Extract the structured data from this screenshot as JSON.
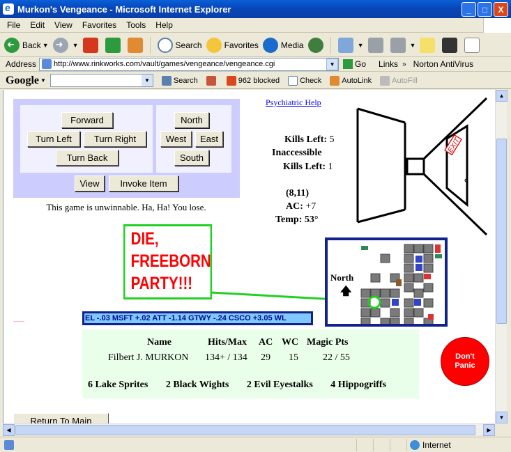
{
  "window": {
    "title": "Murkon's Vengeance - Microsoft Internet Explorer",
    "minimize": "_",
    "maximize": "□",
    "close": "X"
  },
  "menu": [
    "File",
    "Edit",
    "View",
    "Favorites",
    "Tools",
    "Help"
  ],
  "toolbar": {
    "back": "Back",
    "search": "Search",
    "favorites": "Favorites",
    "media": "Media"
  },
  "address": {
    "label": "Address",
    "url": "http://www.rinkworks.com/vault/games/vengeance/vengeance.cgi",
    "go": "Go",
    "links": "Links",
    "extra": "Norton AntiVirus"
  },
  "googlebar": {
    "logo": "Google",
    "search": "Search",
    "blocked": "962 blocked",
    "check": "Check",
    "autolink": "AutoLink",
    "autofill": "AutoFill"
  },
  "controls": {
    "forward": "Forward",
    "turn_left": "Turn Left",
    "turn_right": "Turn Right",
    "turn_back": "Turn Back",
    "north": "North",
    "west": "West",
    "east": "East",
    "south": "South",
    "view": "View",
    "invoke": "Invoke Item"
  },
  "message": "This game is unwinnable.  Ha, Ha!  You lose.",
  "psych_link": "Psychiatric Help",
  "stats": {
    "kills_left_label": "Kills Left:",
    "kills_left_value": "5",
    "inaccessible_label": "Inaccessible",
    "inaccessible_kills_label": "Kills Left:",
    "inaccessible_kills_value": "1",
    "coords": "(8,11)",
    "ac_label": "AC:",
    "ac_value": "+7",
    "temp_label": "Temp:",
    "temp_value": "53°"
  },
  "dungeon": {
    "exit_sign": "EXIT"
  },
  "die_banner": [
    "DIE,",
    "FREEBORN",
    "PARTY!!!"
  ],
  "ticker": "EL -.03    MSFT +.02    ATT -1.14    GTWY -.24    CSCO +3.05    WL",
  "map": {
    "north_label": "North",
    "north_arrow": "🡅"
  },
  "party": {
    "headers": [
      "Name",
      "Hits/Max",
      "AC",
      "WC",
      "Magic Pts"
    ],
    "row": [
      "Filbert J. MURKON",
      "134+ / 134",
      "29",
      "15",
      "22 / 55"
    ],
    "monsters": [
      "6 Lake Sprites",
      "2 Black Wights",
      "2 Evil Eyestalks",
      "4 Hippogriffs"
    ]
  },
  "panic": {
    "line1": "Don't",
    "line2": "Panic"
  },
  "return_button": "Return To Main",
  "status": {
    "zone": "Internet"
  },
  "colors": {
    "control_panel": "#ccccff",
    "ticker_bg": "#80c8ff",
    "banner_text": "#ff0000",
    "banner_border": "#22d022",
    "party_bg": "#eaffea",
    "panic_bg": "#ff0000",
    "link": "#0000ee"
  }
}
